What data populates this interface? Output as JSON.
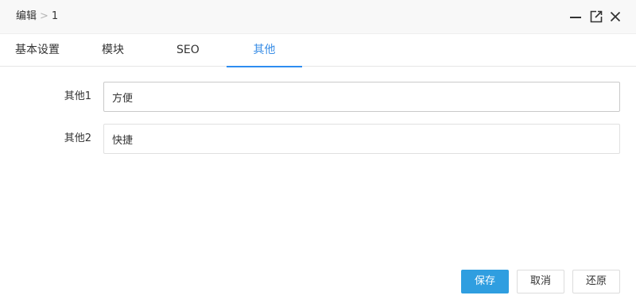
{
  "header": {
    "breadcrumb_parent": "编辑",
    "breadcrumb_separator": ">",
    "breadcrumb_current": "1",
    "controls": [
      "minimize-icon",
      "maximize-icon",
      "close-icon"
    ]
  },
  "tabs": [
    {
      "label": "基本设置",
      "active": false
    },
    {
      "label": "模块",
      "active": false
    },
    {
      "label": "SEO",
      "active": false
    },
    {
      "label": "其他",
      "active": true
    }
  ],
  "form": {
    "fields": [
      {
        "label": "其他1",
        "value": "方便"
      },
      {
        "label": "其他2",
        "value": "快捷"
      }
    ]
  },
  "footer": {
    "save_label": "保存",
    "cancel_label": "取消",
    "reset_label": "还原"
  },
  "colors": {
    "accent": "#2f9ee0",
    "active_tab": "#3a8ee6"
  }
}
